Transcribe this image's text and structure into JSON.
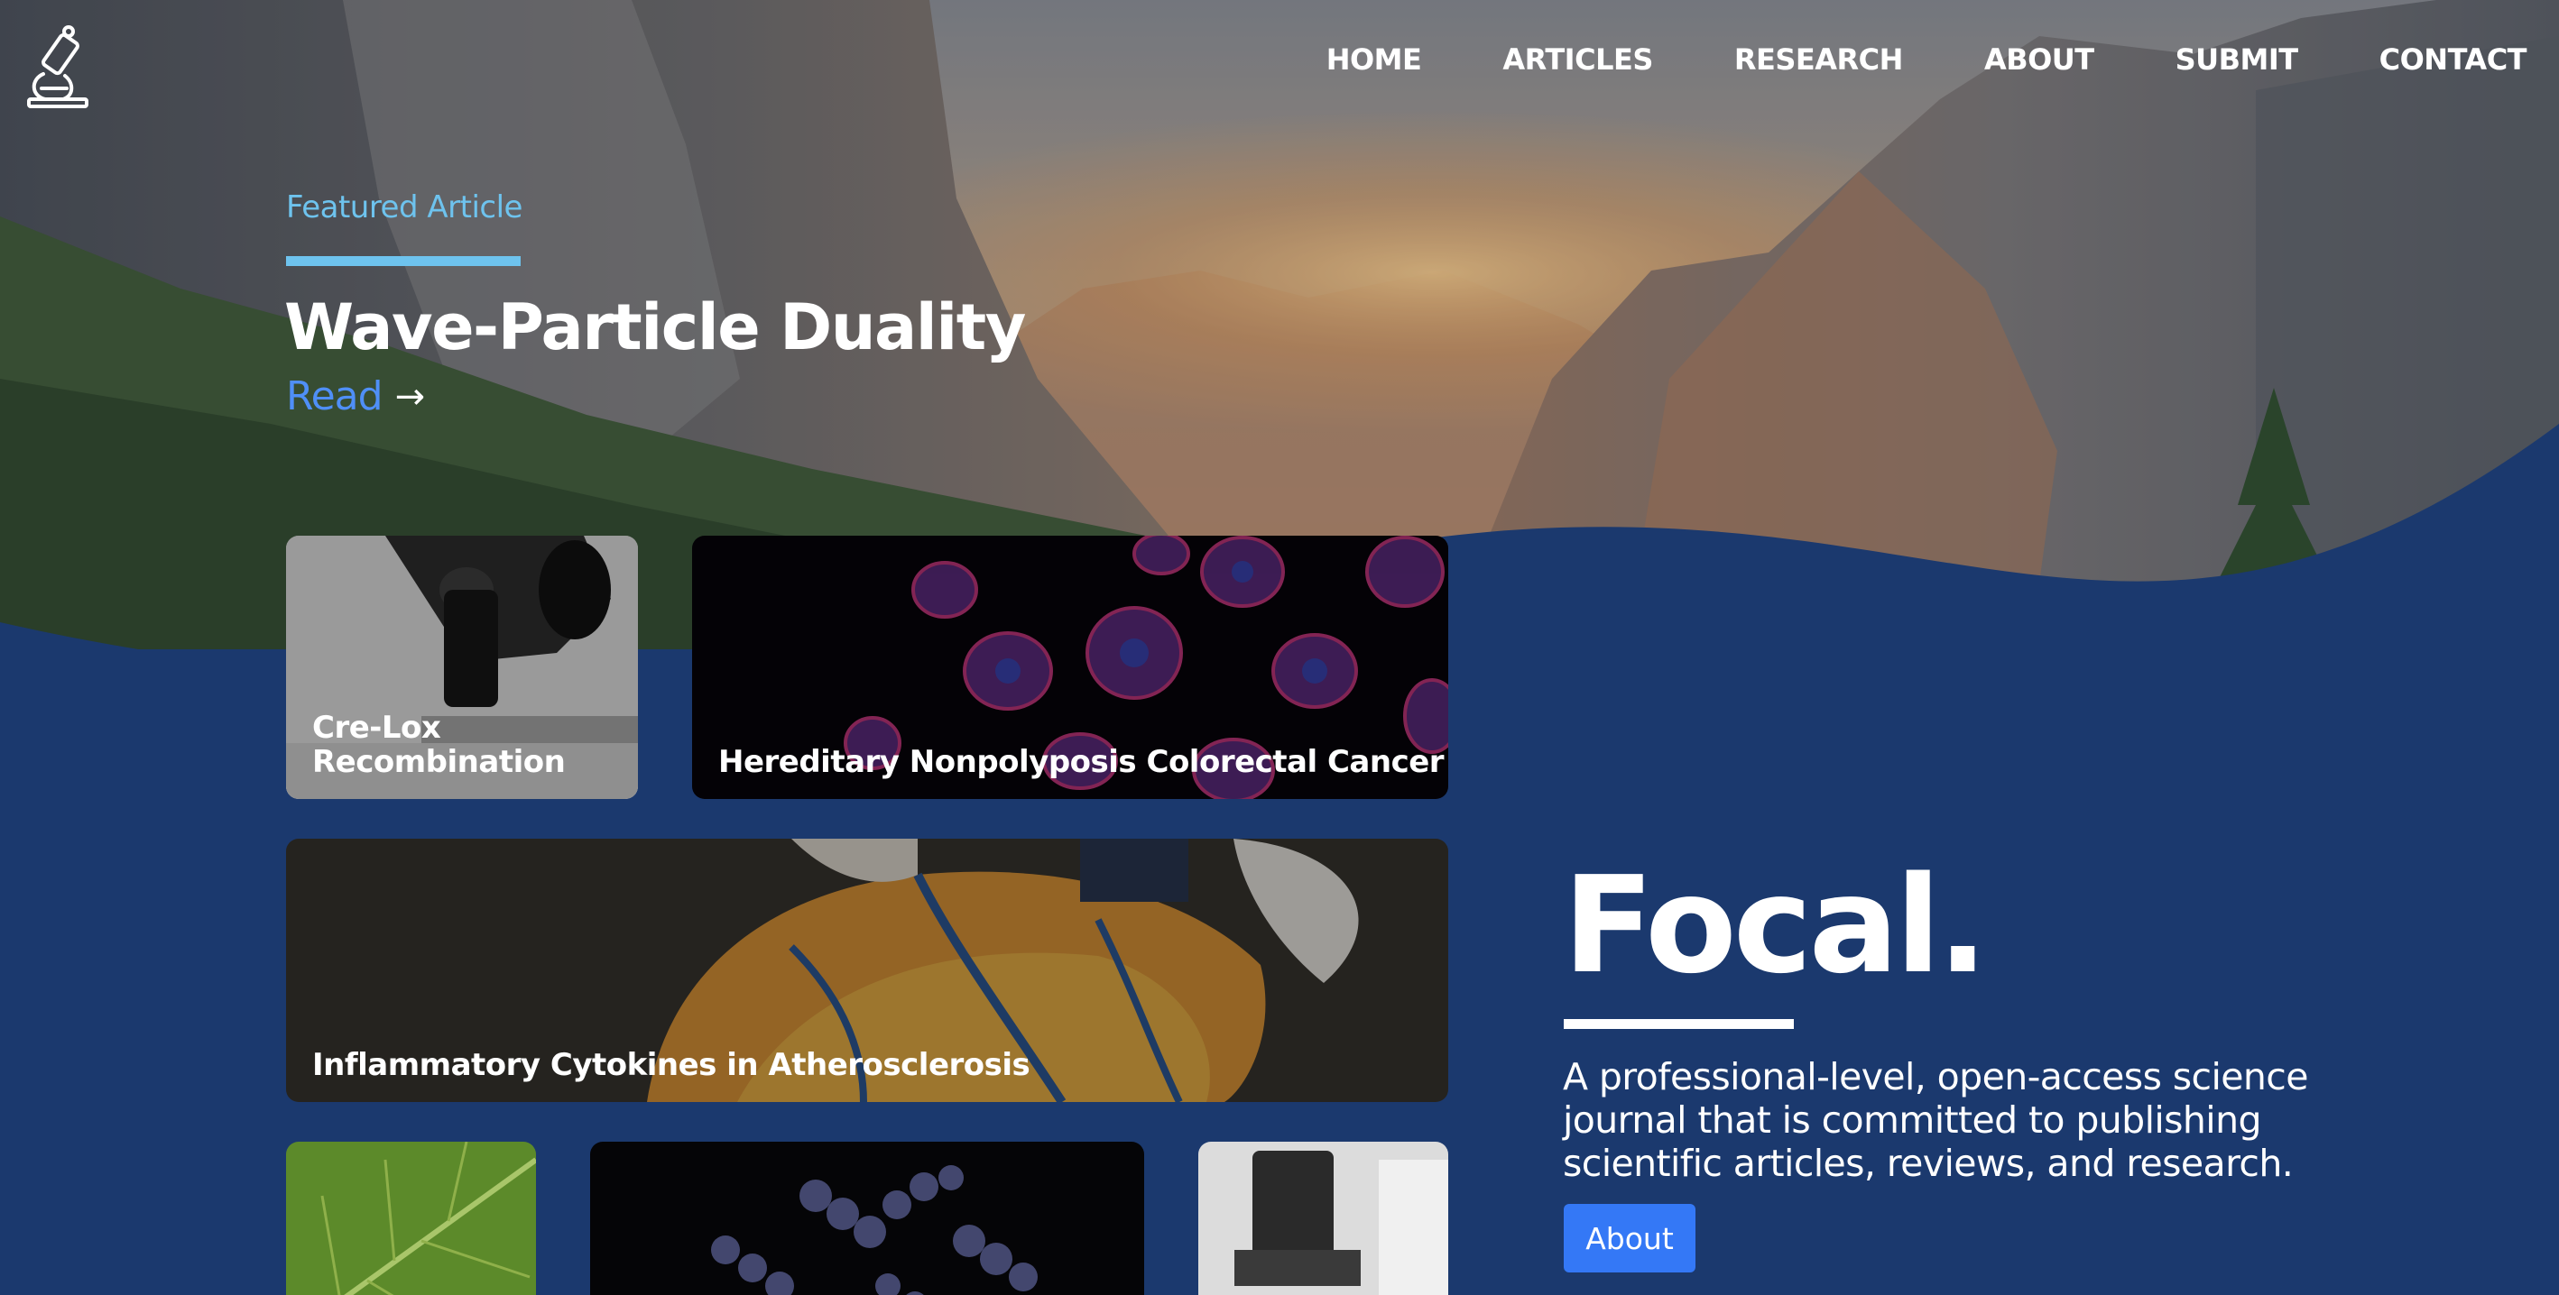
{
  "nav": {
    "logo_icon": "microscope-icon",
    "items": [
      {
        "label": "HOME"
      },
      {
        "label": "ARTICLES"
      },
      {
        "label": "RESEARCH"
      },
      {
        "label": "ABOUT"
      },
      {
        "label": "SUBMIT"
      },
      {
        "label": "CONTACT"
      }
    ]
  },
  "featured": {
    "label": "Featured Article",
    "title": "Wave-Particle Duality",
    "read_label": "Read",
    "read_icon": "arrow-right-icon"
  },
  "articles": [
    {
      "title": "Cre-Lox Recombination",
      "line1": "Cre-Lox",
      "line2": "Recombination"
    },
    {
      "title": "Hereditary Nonpolyposis Colorectal Cancer"
    },
    {
      "title": "Inflammatory Cytokines in Atherosclerosis"
    }
  ],
  "brand": {
    "name": "Focal.",
    "tagline": "A professional-level, open-access science journal that is committed to publishing scientific articles, reviews, and research.",
    "about_label": "About"
  },
  "colors": {
    "background": "#1b396e",
    "accent_light_blue": "#6ec3ee",
    "link_blue": "#4f8ff7",
    "button_blue": "#3478f6"
  }
}
